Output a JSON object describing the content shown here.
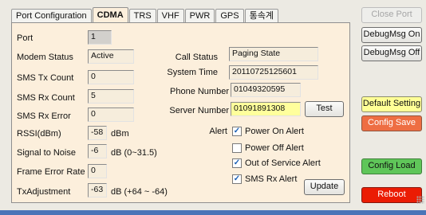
{
  "tabs": [
    {
      "label": "Port Configuration",
      "active": false
    },
    {
      "label": "CDMA",
      "active": true
    },
    {
      "label": "TRS",
      "active": false
    },
    {
      "label": "VHF",
      "active": false
    },
    {
      "label": "PWR",
      "active": false
    },
    {
      "label": "GPS",
      "active": false
    },
    {
      "label": "통속계",
      "active": false
    }
  ],
  "left": {
    "port": {
      "label": "Port",
      "value": "1"
    },
    "modem_status": {
      "label": "Modem Status",
      "value": "Active"
    },
    "sms_tx": {
      "label": "SMS Tx Count",
      "value": "0"
    },
    "sms_rx": {
      "label": "SMS Rx Count",
      "value": "5"
    },
    "sms_rx_error": {
      "label": "SMS Rx Error",
      "value": "0"
    },
    "rssi": {
      "label": "RSSI(dBm)",
      "value": "-58",
      "unit": "dBm"
    },
    "snr": {
      "label": "Signal to Noise",
      "value": "-6",
      "unit": "dB (0~31.5)"
    },
    "fer": {
      "label": "Frame Error Rate",
      "value": "0"
    },
    "txadj": {
      "label": "TxAdjustment",
      "value": "-63",
      "unit": "dB (+64 ~ -64)"
    }
  },
  "right": {
    "call_status": {
      "label": "Call Status",
      "value": "Paging State"
    },
    "system_time": {
      "label": "System Time",
      "value": "20110725125601"
    },
    "phone_number": {
      "label": "Phone Number",
      "value": "01049320595"
    },
    "server_number": {
      "label": "Server Number",
      "value": "01091891308"
    },
    "test_button": "Test",
    "alert_label": "Alert",
    "alerts": [
      {
        "label": "Power On Alert",
        "checked": true
      },
      {
        "label": "Power Off Alert",
        "checked": false
      },
      {
        "label": "Out of Service Alert",
        "checked": true
      },
      {
        "label": "SMS Rx Alert",
        "checked": true
      }
    ],
    "update_button": "Update"
  },
  "side_buttons": {
    "close_port": "Close Port",
    "debugmsg_on": "DebugMsg On",
    "debugmsg_off": "DebugMsg Off",
    "default_setting": "Default Setting",
    "config_save": "Config Save",
    "config_load": "Config Load",
    "reboot": "Reboot"
  },
  "colors": {
    "panel_bg": "#fcefdc",
    "highlight_field": "#ffff9c",
    "default_setting": "#ffff96",
    "config_save": "#ee6e43",
    "config_load": "#5fc659",
    "reboot": "#eb1c04",
    "window_border": "#4b74b8"
  }
}
